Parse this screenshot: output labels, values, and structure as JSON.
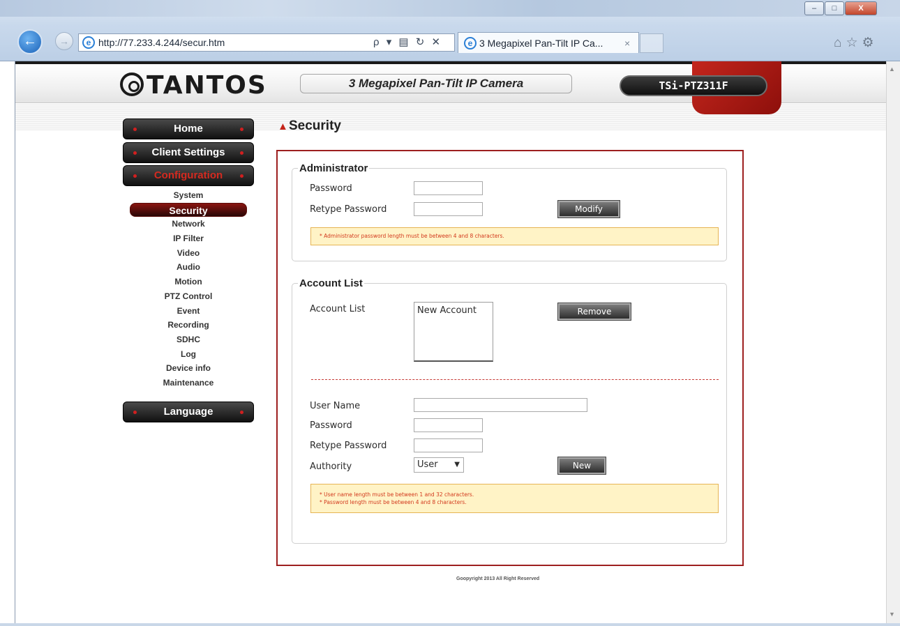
{
  "browser": {
    "address": "http://77.233.4.244/secur.htm",
    "tab_title": "3 Megapixel Pan-Tilt IP Ca...",
    "tab_close": "×",
    "address_tools": "ρ ▾ ▤ ↻ ✕",
    "window_buttons": {
      "minimize": "–",
      "maximize": "□",
      "close": "X"
    },
    "right_icons": "⌂☆⚙"
  },
  "header": {
    "logo": "TANTOS",
    "product": "3 Megapixel Pan-Tilt IP Camera",
    "model": "TSi-PTZ311F"
  },
  "sidebar": {
    "home": "Home",
    "client_settings": "Client Settings",
    "configuration": "Configuration",
    "language": "Language",
    "items": [
      "System",
      "Security",
      "Network",
      "IP Filter",
      "Video",
      "Audio",
      "Motion",
      "PTZ Control",
      "Event",
      "Recording",
      "SDHC",
      "Log",
      "Device info",
      "Maintenance"
    ],
    "active_item": "Security"
  },
  "page": {
    "title": "Security",
    "admin": {
      "legend": "Administrator",
      "password_label": "Password",
      "retype_label": "Retype Password",
      "modify_button": "Modify",
      "note": "* Administrator password length must be between 4 and 8 characters."
    },
    "accounts": {
      "legend": "Account List",
      "list_label": "Account List",
      "list_items": [
        "New Account"
      ],
      "remove_button": "Remove",
      "username_label": "User Name",
      "password_label": "Password",
      "retype_label": "Retype Password",
      "authority_label": "Authority",
      "authority_value": "User",
      "new_button": "New",
      "note_line1": "* User name length must be between 1 and 32 characters.",
      "note_line2": "* Password length must be between 4 and 8 characters."
    },
    "footer": "Goopyright 2013 All Right Reserved"
  }
}
